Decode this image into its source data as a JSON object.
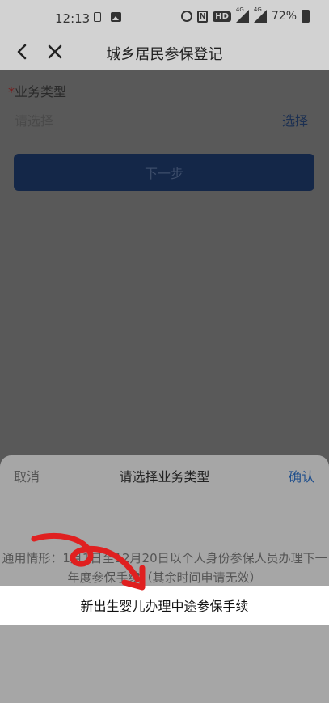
{
  "status_bar": {
    "time": "12:13",
    "hd": "HD",
    "network": "4G",
    "battery": "72%"
  },
  "nav": {
    "back_icon": "chevron-left-icon",
    "close_icon": "close-icon",
    "title": "城乡居民参保登记"
  },
  "form": {
    "required_mark": "*",
    "label": "业务类型",
    "placeholder": "请选择",
    "select_label": "选择",
    "next_button": "下一步"
  },
  "sheet": {
    "cancel": "取消",
    "title": "请选择业务类型",
    "confirm": "确认",
    "options": [
      "通用情形：1月1日至12月20日以个人身份参保人员办理下一年度参保手续（其余时间申请无效）",
      "新出生婴儿办理中途参保手续"
    ],
    "selected_index": 1
  },
  "colors": {
    "annotation": "#e02020",
    "confirm": "#1e4e8c"
  }
}
